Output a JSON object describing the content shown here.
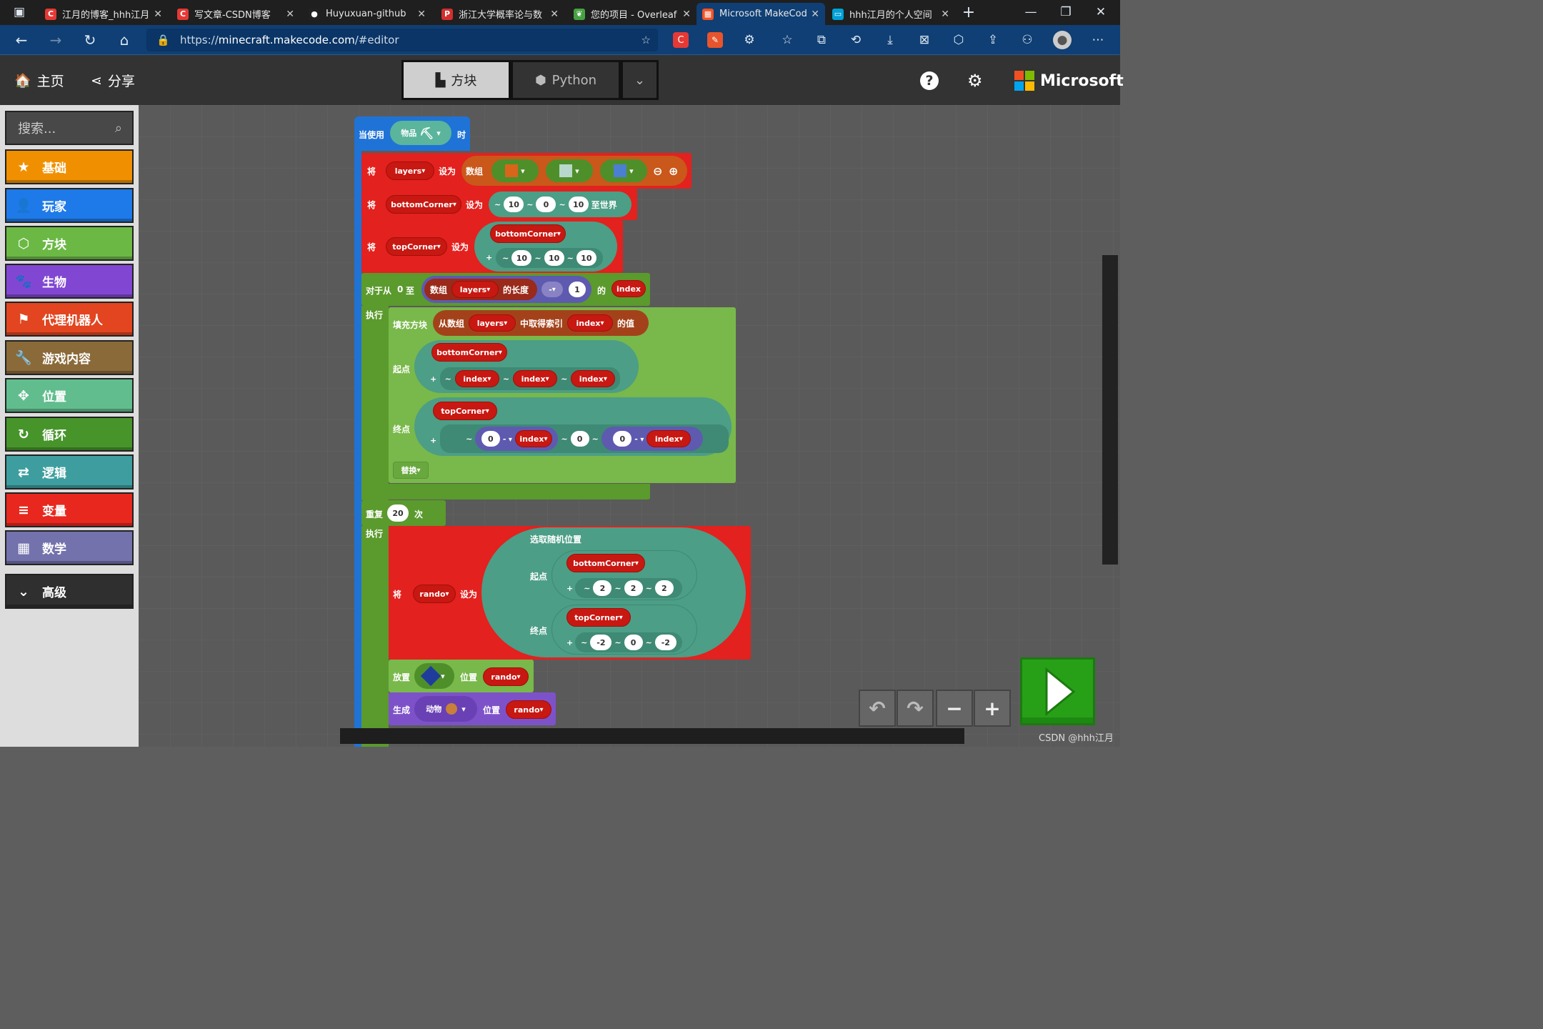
{
  "browser": {
    "tabs": [
      {
        "title": "江月的博客_hhh江月",
        "icon": "csdn-icon",
        "color": "#e53935",
        "active": false
      },
      {
        "title": "写文章-CSDN博客",
        "icon": "csdn-icon",
        "color": "#e53935",
        "active": false
      },
      {
        "title": "Huyuxuan-github",
        "icon": "github-icon",
        "color": "#222222",
        "active": false
      },
      {
        "title": "浙江大学概率论与数",
        "icon": "pdf-icon",
        "color": "#d32f2f",
        "active": false
      },
      {
        "title": "您的项目 - Overleaf",
        "icon": "overleaf-icon",
        "color": "#47a141",
        "active": false
      },
      {
        "title": "Microsoft MakeCode",
        "icon": "microsoft-icon",
        "color": "#f35325",
        "active": true
      },
      {
        "title": "hhh江月的个人空间",
        "icon": "bilibili-icon",
        "color": "#00a1d6",
        "active": false
      }
    ],
    "url_prefix": "https://",
    "url_host": "minecraft.makecode.com",
    "url_path": "/#editor"
  },
  "header": {
    "home": "主页",
    "share": "分享",
    "mode_blocks": "方块",
    "mode_python": "Python",
    "brand": "Microsoft"
  },
  "toolbox": {
    "search_placeholder": "搜索...",
    "categories": [
      {
        "label": "基础",
        "color": "#f09000",
        "icon": "★"
      },
      {
        "label": "玩家",
        "color": "#1e7ae8",
        "icon": "👤"
      },
      {
        "label": "方块",
        "color": "#6bb944",
        "icon": "⬡"
      },
      {
        "label": "生物",
        "color": "#8147d2",
        "icon": "🐾"
      },
      {
        "label": "代理机器人",
        "color": "#e2451f",
        "icon": "⚑"
      },
      {
        "label": "游戏内容",
        "color": "#8b6a3a",
        "icon": "🔧"
      },
      {
        "label": "位置",
        "color": "#61bd8d",
        "icon": "✥"
      },
      {
        "label": "循环",
        "color": "#47942b",
        "icon": "↻"
      },
      {
        "label": "逻辑",
        "color": "#3e9e9f",
        "icon": "⇄"
      },
      {
        "label": "变量",
        "color": "#e8281e",
        "icon": "≡"
      },
      {
        "label": "数学",
        "color": "#7372ad",
        "icon": "▦"
      },
      {
        "label": "高级",
        "color": "#2f2f2f",
        "icon": "⌄"
      }
    ]
  },
  "blocks": {
    "event": {
      "prefix": "当使用",
      "item": "物品",
      "suffix": "时"
    },
    "set1": {
      "kw": "将",
      "var": "layers",
      "set": "设为",
      "array": "数组"
    },
    "set2": {
      "kw": "将",
      "var": "bottomCorner",
      "set": "设为",
      "x": "10",
      "y": "0",
      "z": "10",
      "tail": "至世界"
    },
    "set3": {
      "kw": "将",
      "var": "topCorner",
      "set": "设为",
      "base": "bottomCorner",
      "x": "10",
      "y": "10",
      "z": "10"
    },
    "for": {
      "head": "对于从",
      "start": "0",
      "to": "至",
      "array": "数组",
      "arr": "layers",
      "len": "的长度",
      "op": "-",
      "one": "1",
      "of": "的",
      "idx": "index",
      "do": "执行"
    },
    "fill": {
      "head": "填充方块",
      "from": "从数组",
      "arr": "layers",
      "take": "中取得索引",
      "idx": "index",
      "val": "的值",
      "start_lbl": "起点",
      "start_base": "bottomCorner",
      "sx": "index",
      "sy": "index",
      "sz": "index",
      "end_lbl": "终点",
      "end_base": "topCorner",
      "e0": "0",
      "eminus": "-",
      "eidx": "index",
      "emid": "0",
      "e2": "0",
      "e2minus": "-",
      "e2idx": "index",
      "mode": "替换"
    },
    "repeat": {
      "head": "重复",
      "n": "20",
      "times": "次",
      "do": "执行"
    },
    "rando": {
      "kw": "将",
      "var": "rando",
      "set": "设为",
      "pick": "选取随机位置",
      "start_lbl": "起点",
      "start_base": "bottomCorner",
      "sx": "2",
      "sy": "2",
      "sz": "2",
      "end_lbl": "终点",
      "end_base": "topCorner",
      "ex": "-2",
      "ey": "0",
      "ez": "-2"
    },
    "place": {
      "kw": "放置",
      "pos": "位置",
      "var": "rando"
    },
    "spawn": {
      "kw": "生成",
      "animal": "动物",
      "pos": "位置",
      "var": "rando"
    }
  },
  "watermark": "CSDN @hhh江月"
}
